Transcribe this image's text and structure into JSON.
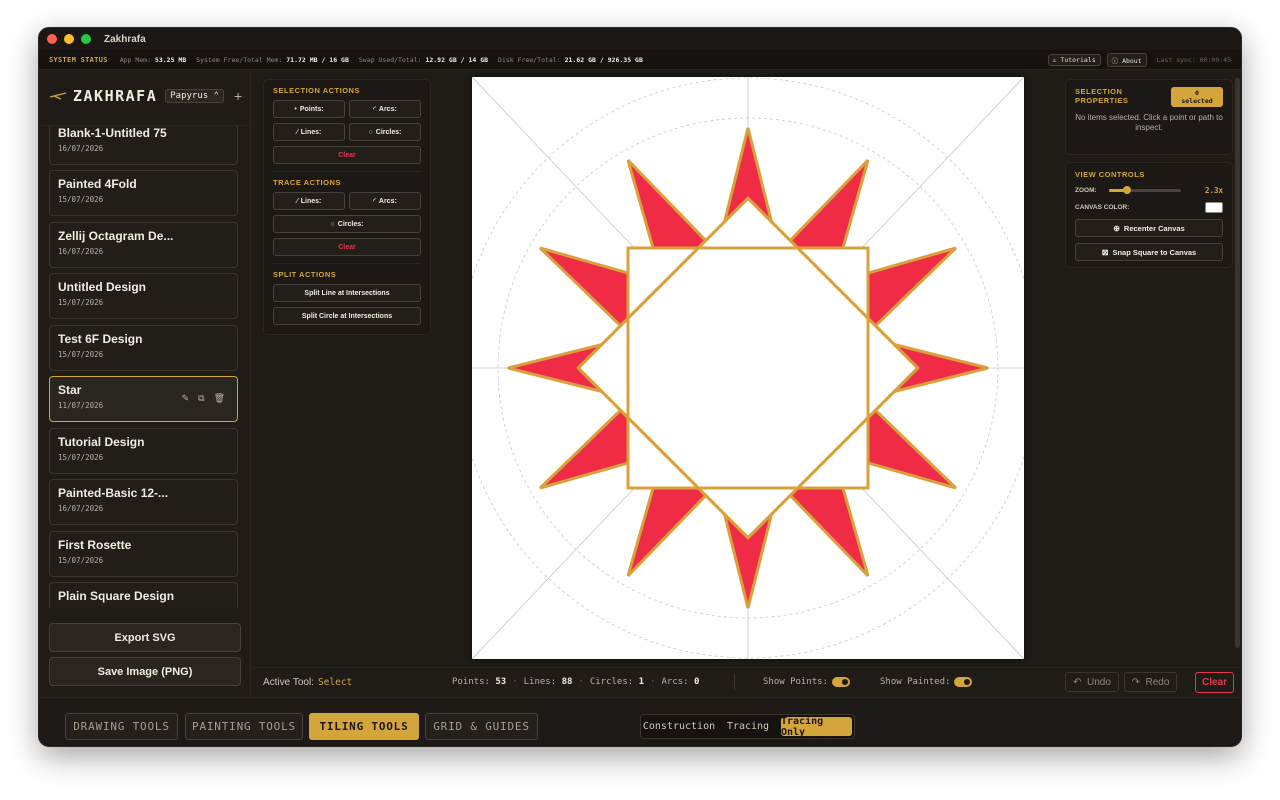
{
  "window": {
    "title": "Zakhrafa"
  },
  "status": {
    "label": "SYSTEM STATUS",
    "stats": [
      {
        "label": "App Mem:",
        "value": "53.25 MB"
      },
      {
        "label": "System Free/Total Mem:",
        "value": "71.72 MB / 16 GB"
      },
      {
        "label": "Swap Used/Total:",
        "value": "12.92 GB / 14 GB"
      },
      {
        "label": "Disk Free/Total:",
        "value": "21.62 GB / 926.35 GB"
      }
    ],
    "tutorials_label": "Tutorials",
    "about_label": "About",
    "last_sync": "Last sync: 00:00:45"
  },
  "brand": {
    "name": "ZAKHRAFA",
    "font_selected": "Papyrus",
    "add_icon": "plus-icon"
  },
  "designs": [
    {
      "name": "Blank-1-Untitled 75",
      "date": "16/07/2026"
    },
    {
      "name": "Painted 4Fold",
      "date": "15/07/2026"
    },
    {
      "name": "Zellij Octagram De...",
      "date": "16/07/2026"
    },
    {
      "name": "Untitled Design",
      "date": "15/07/2026"
    },
    {
      "name": "Test 6F Design",
      "date": "15/07/2026"
    },
    {
      "name": "Star",
      "date": "11/07/2026",
      "active": true
    },
    {
      "name": "Tutorial Design",
      "date": "15/07/2026"
    },
    {
      "name": "Painted-Basic 12-...",
      "date": "16/07/2026"
    },
    {
      "name": "First Rosette",
      "date": "15/07/2026"
    },
    {
      "name": "Plain Square Design",
      "date": ""
    }
  ],
  "sidebar_buttons": {
    "export_svg": "Export SVG",
    "save_png": "Save Image (PNG)"
  },
  "actions": {
    "selection_title": "SELECTION ACTIONS",
    "selection": {
      "points": "Points:",
      "arcs": "Arcs:",
      "lines": "Lines:",
      "circles": "Circles:",
      "clear": "Clear"
    },
    "trace_title": "TRACE ACTIONS",
    "trace": {
      "lines": "Lines:",
      "arcs": "Arcs:",
      "circles": "Circles:",
      "clear": "Clear"
    },
    "split_title": "SPLIT ACTIONS",
    "split": {
      "line": "Split Line at Intersections",
      "circle": "Split Circle at Intersections"
    }
  },
  "selection_props": {
    "title_line1": "SELECTION",
    "title_line2": "PROPERTIES",
    "badge_count": "0",
    "badge_label": "selected",
    "empty": "No items selected. Click a point or path to inspect."
  },
  "view_controls": {
    "title": "VIEW CONTROLS",
    "zoom_label": "ZOOM:",
    "zoom_value": "2.3x",
    "zoom_fraction": 0.25,
    "canvas_color_label": "CANVAS COLOR:",
    "canvas_color": "#ffffff",
    "recenter": "Recenter Canvas",
    "snap": "Snap Square to Canvas"
  },
  "toolbar": {
    "active_tool_label": "Active Tool:",
    "active_tool": "Select",
    "counts": [
      {
        "label": "Points:",
        "value": "53"
      },
      {
        "label": "Lines:",
        "value": "88"
      },
      {
        "label": "Circles:",
        "value": "1"
      },
      {
        "label": "Arcs:",
        "value": "0"
      }
    ],
    "show_points": "Show Points:",
    "show_painted": "Show Painted:",
    "undo": "Undo",
    "redo": "Redo",
    "clear": "Clear"
  },
  "tabs": [
    "DRAWING TOOLS",
    "PAINTING TOOLS",
    "TILING TOOLS",
    "GRID & GUIDES"
  ],
  "active_tab": "TILING TOOLS",
  "modes": [
    "Construction",
    "Tracing",
    "Tracing Only"
  ],
  "active_mode": "Tracing Only",
  "colors": {
    "accent": "#d4a53a",
    "danger": "#e8364c",
    "star_fill": "#f02b45",
    "star_stroke": "#d9a03c",
    "background": "#1f1b17"
  }
}
